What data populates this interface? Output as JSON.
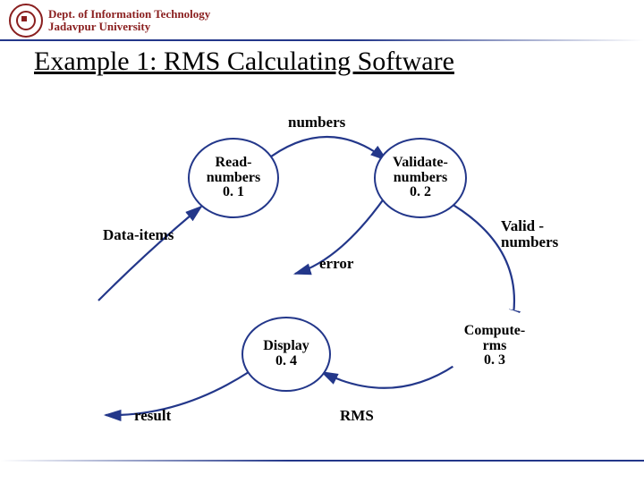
{
  "header": {
    "dept_line1": "Dept. of Information Technology",
    "dept_line2": "Jadavpur University"
  },
  "title": "Example 1: RMS Calculating Software",
  "nodes": {
    "read": {
      "line1": "Read-",
      "line2": "numbers",
      "line3": "0. 1"
    },
    "validate": {
      "line1": "Validate-",
      "line2": "numbers",
      "line3": "0. 2"
    },
    "compute": {
      "line1": "Compute-",
      "line2": "rms",
      "line3": "0. 3"
    },
    "display": {
      "line1": "Display",
      "line2": "0. 4"
    }
  },
  "labels": {
    "numbers": "numbers",
    "data_items": "Data-items",
    "error": "error",
    "valid_line1": "Valid -",
    "valid_line2": "numbers",
    "result": "result",
    "rms": "RMS"
  }
}
